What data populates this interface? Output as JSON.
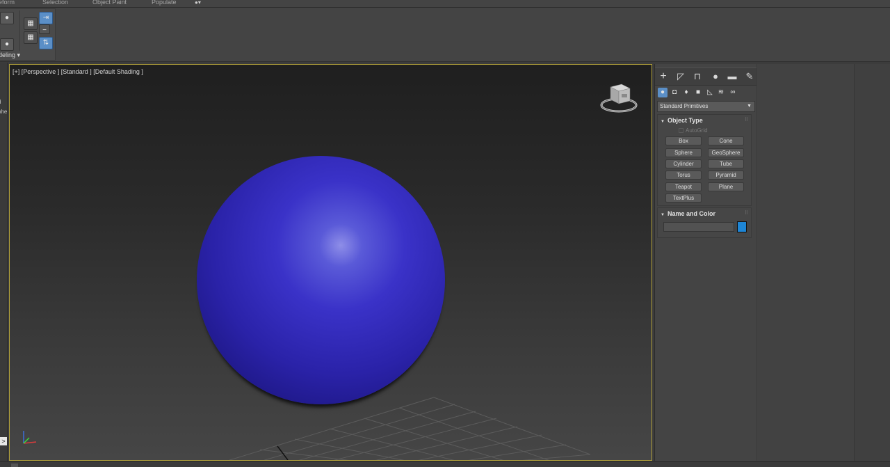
{
  "ribbon": {
    "tabs": [
      "eform",
      "Selection",
      "Object Paint",
      "Populate"
    ],
    "tab_dropdown_glyph": "▾",
    "group_label": "deling ▾",
    "buttons": [
      "sphere-icon",
      "cylinder-icon",
      "grid-box-icon",
      "grid-box-icon",
      "align-icon",
      "minus-icon",
      "swap-icon"
    ]
  },
  "left_strip": {
    "text_1": "d",
    "text_2": "phe",
    "expand_glyph": ">"
  },
  "viewport": {
    "label": "[+] [Perspective ] [Standard ] [Default Shading ]",
    "object": "sphere",
    "object_color": "#2a22a8",
    "active_border_color": "#b3a23a"
  },
  "command_panel": {
    "tabs": [
      "create-icon",
      "modify-icon",
      "hierarchy-icon",
      "motion-icon",
      "display-icon",
      "utilities-icon"
    ],
    "subcategories": [
      "geometry-icon",
      "shapes-icon",
      "lights-icon",
      "cameras-icon",
      "helpers-icon",
      "spacewarps-icon",
      "systems-icon"
    ],
    "category_select": "Standard Primitives",
    "object_type": {
      "title": "Object Type",
      "autogrid": "AutoGrid",
      "buttons": [
        "Box",
        "Cone",
        "Sphere",
        "GeoSphere",
        "Cylinder",
        "Tube",
        "Torus",
        "Pyramid",
        "Teapot",
        "Plane",
        "TextPlus"
      ]
    },
    "name_and_color": {
      "title": "Name and Color",
      "name_value": "",
      "swatch_color": "#1e86d6"
    }
  }
}
